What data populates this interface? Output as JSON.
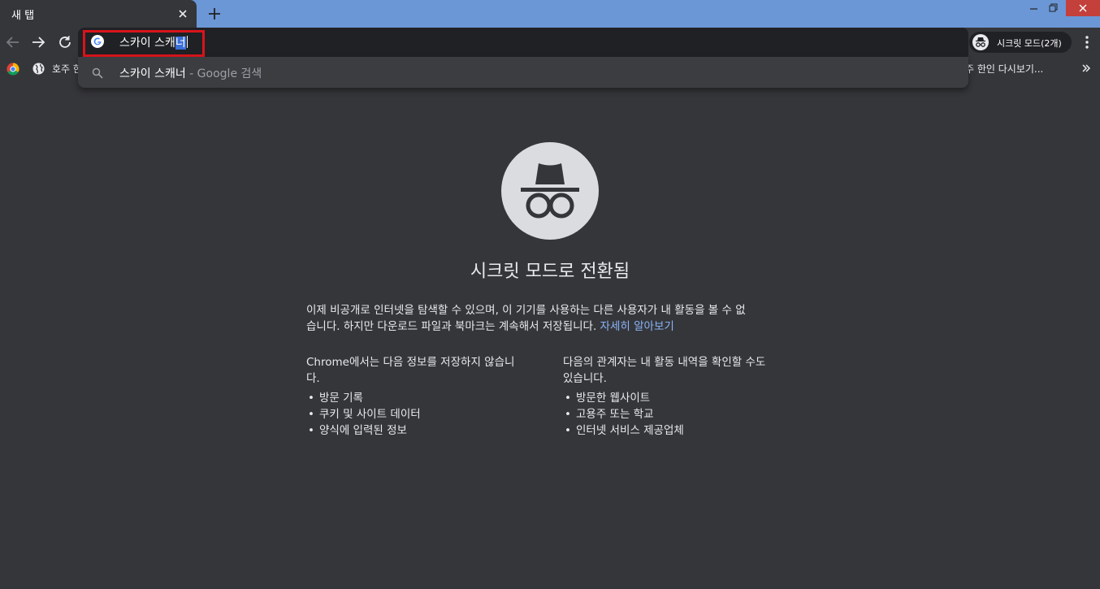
{
  "tab": {
    "title": "새 탭",
    "close_icon": "close-icon",
    "new_tab_icon": "plus-icon"
  },
  "window_controls": [
    "minimize-icon",
    "restore-icon",
    "close-icon"
  ],
  "toolbar": {
    "back_icon": "arrow-left-icon",
    "forward_icon": "arrow-right-icon",
    "reload_icon": "reload-icon"
  },
  "omnibox": {
    "favicon": "google-g-icon",
    "value_prefix": "스카이 스캐",
    "value_selected": "너",
    "highlight_color": "#d9141c"
  },
  "incognito_chip": {
    "label": "시크릿 모드(2개)",
    "icon": "incognito-icon"
  },
  "menu_icon": "kebab-menu-icon",
  "bookmarks": {
    "item1_label": "호주 한",
    "item2_label": "주 한인 다시보기...",
    "more_icon": "chevron-double-right-icon"
  },
  "suggestion": {
    "icon": "search-icon",
    "query": "스카이 스캐너",
    "suffix": " - Google 검색"
  },
  "content": {
    "heading": "시크릿 모드로 전환됨",
    "intro_line1": "이제 비공개로 인터넷을 탐색할 수 있으며, 이 기기를 사용하는 다른 사용자가 내 활동을 볼 수 없",
    "intro_line2": "습니다. 하지만 다운로드 파일과 북마크는 계속해서 저장됩니다.",
    "learn_more": "자세히 알아보기",
    "left_col": {
      "heading_line1": "Chrome에서는 다음 정보를 저장하지 않습니",
      "heading_line2": "다.",
      "items": [
        "방문 기록",
        "쿠키 및 사이트 데이터",
        "양식에 입력된 정보"
      ]
    },
    "right_col": {
      "heading_line1": "다음의 관계자는 내 활동 내역을 확인할 수도",
      "heading_line2": "있습니다.",
      "items": [
        "방문한 웹사이트",
        "고용주 또는 학교",
        "인터넷 서비스 제공업체"
      ]
    }
  },
  "colors": {
    "titlebar": "#6b97d6",
    "background": "#35363a",
    "omnibox": "#202124",
    "link": "#8ab4f8",
    "window_close": "#c4403a"
  }
}
